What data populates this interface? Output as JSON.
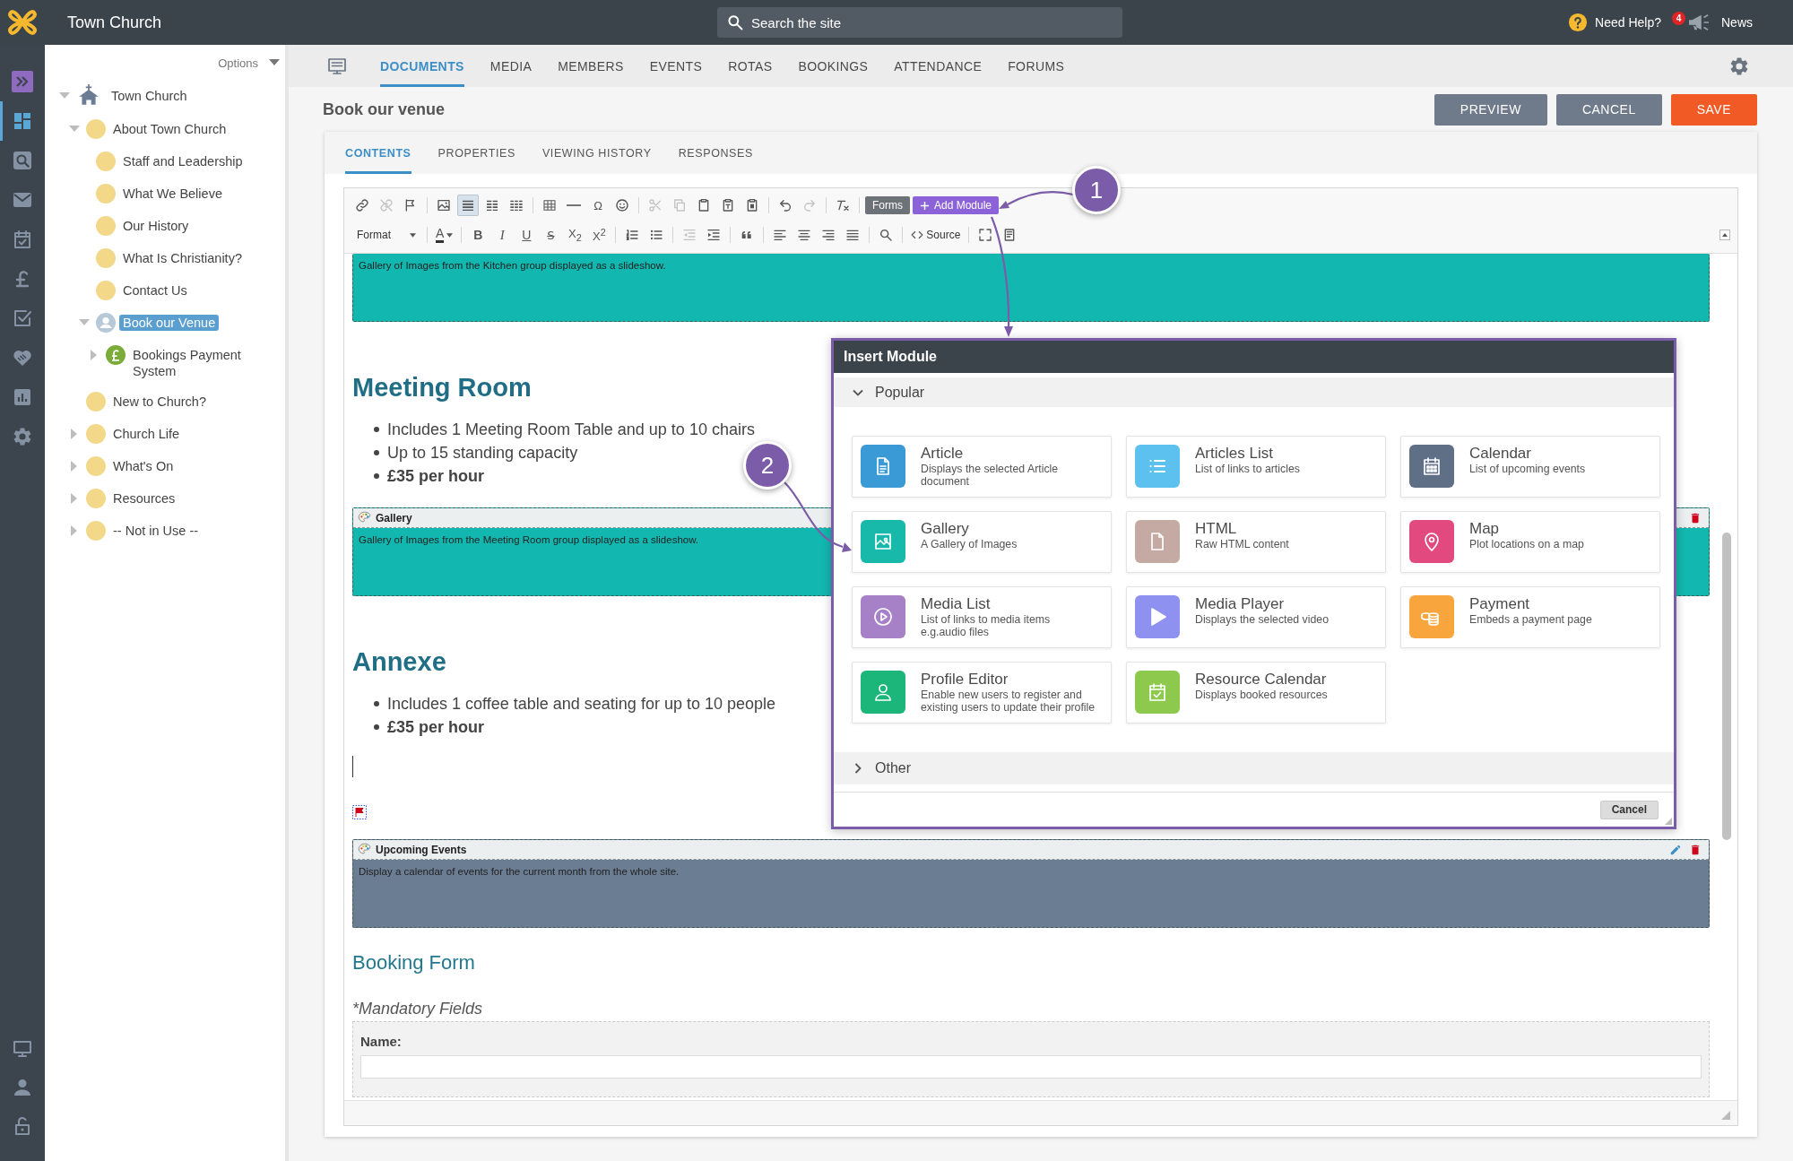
{
  "top_bar": {
    "site_name": "Town Church",
    "search": {
      "placeholder": "Search the site"
    },
    "help_label": "Need Help?",
    "news_count": "4",
    "news_label": "News"
  },
  "side_rail": {
    "items": [
      {
        "selected": true
      },
      {
        "selected": false
      },
      {
        "selected": false
      },
      {
        "selected": false
      },
      {
        "selected": false
      },
      {
        "selected": false
      },
      {
        "selected": false
      },
      {
        "selected": false
      },
      {
        "selected": false
      }
    ],
    "bottom_items": [
      {
        "selected": false
      },
      {
        "selected": false
      },
      {
        "selected": false
      }
    ]
  },
  "page_tree": {
    "options_label": "Options",
    "items": [
      {
        "label": "Town Church",
        "kind": "home",
        "expandable": true,
        "expanded": true,
        "selected": false,
        "children": [
          {
            "label": "About Town Church",
            "kind": "page",
            "expandable": true,
            "expanded": true,
            "selected": false,
            "children": [
              {
                "label": "Staff and Leadership",
                "kind": "page",
                "expandable": false,
                "selected": false
              },
              {
                "label": "What We Believe",
                "kind": "page",
                "expandable": false,
                "selected": false
              },
              {
                "label": "Our History",
                "kind": "page",
                "expandable": false,
                "selected": false
              },
              {
                "label": "What Is Christianity?",
                "kind": "page",
                "expandable": false,
                "selected": false
              },
              {
                "label": "Contact Us",
                "kind": "page",
                "expandable": false,
                "selected": false
              },
              {
                "label": "Book our Venue",
                "kind": "form",
                "expandable": true,
                "expanded": true,
                "selected": true,
                "children": [
                  {
                    "label": "Bookings Payment System",
                    "kind": "payment",
                    "expandable": true,
                    "expanded": false,
                    "selected": false
                  }
                ]
              }
            ]
          },
          {
            "label": "New to Church?",
            "kind": "page",
            "expandable": false,
            "selected": false
          },
          {
            "label": "Church Life",
            "kind": "page",
            "expandable": true,
            "expanded": false,
            "selected": false
          },
          {
            "label": "What's On",
            "kind": "page",
            "expandable": true,
            "expanded": false,
            "selected": false
          },
          {
            "label": "Resources",
            "kind": "page",
            "expandable": true,
            "expanded": false,
            "selected": false
          },
          {
            "label": "-- Not in Use --",
            "kind": "page",
            "expandable": true,
            "expanded": false,
            "selected": false
          }
        ]
      }
    ]
  },
  "nav_tabs": [
    {
      "label": "DOCUMENTS",
      "selected": true
    },
    {
      "label": "MEDIA",
      "selected": false
    },
    {
      "label": "MEMBERS",
      "selected": false
    },
    {
      "label": "EVENTS",
      "selected": false
    },
    {
      "label": "ROTAS",
      "selected": false
    },
    {
      "label": "BOOKINGS",
      "selected": false
    },
    {
      "label": "ATTENDANCE",
      "selected": false
    },
    {
      "label": "FORUMS",
      "selected": false
    }
  ],
  "page_header": {
    "title": "Book our venue",
    "buttons": [
      {
        "label": "PREVIEW",
        "kind": "secondary"
      },
      {
        "label": "CANCEL",
        "kind": "secondary"
      },
      {
        "label": "SAVE",
        "kind": "primary"
      }
    ]
  },
  "editor_tabs": [
    {
      "label": "CONTENTS",
      "selected": true
    },
    {
      "label": "PROPERTIES",
      "selected": false
    },
    {
      "label": "VIEWING HISTORY",
      "selected": false
    },
    {
      "label": "RESPONSES",
      "selected": false
    }
  ],
  "editor": {
    "toolbar": {
      "rows": [
        [
          {
            "kind": "icon",
            "disabled": false,
            "pressed": false
          },
          {
            "kind": "icon",
            "disabled": true,
            "pressed": false
          },
          {
            "kind": "icon",
            "disabled": false,
            "pressed": false
          },
          {
            "kind": "separator"
          },
          {
            "kind": "icon",
            "disabled": false,
            "pressed": false
          },
          {
            "kind": "icon",
            "disabled": false,
            "pressed": true
          },
          {
            "kind": "icon",
            "disabled": false,
            "pressed": false
          },
          {
            "kind": "icon",
            "disabled": false,
            "pressed": false
          },
          {
            "kind": "separator"
          },
          {
            "kind": "icon",
            "disabled": false,
            "pressed": false
          },
          {
            "kind": "icon",
            "disabled": false,
            "pressed": false
          },
          {
            "kind": "glyph",
            "label": "Ω",
            "disabled": false,
            "pressed": false
          },
          {
            "kind": "icon",
            "disabled": false,
            "pressed": false
          },
          {
            "kind": "separator"
          },
          {
            "kind": "icon",
            "disabled": true,
            "pressed": false
          },
          {
            "kind": "icon",
            "disabled": true,
            "pressed": false
          },
          {
            "kind": "icon",
            "disabled": false,
            "pressed": false
          },
          {
            "kind": "icon",
            "disabled": false,
            "pressed": false
          },
          {
            "kind": "icon",
            "disabled": false,
            "pressed": false
          },
          {
            "kind": "separator"
          },
          {
            "kind": "icon",
            "disabled": false,
            "pressed": false
          },
          {
            "kind": "icon",
            "disabled": true,
            "pressed": false
          },
          {
            "kind": "separator"
          },
          {
            "kind": "icon",
            "disabled": false,
            "pressed": false
          },
          {
            "kind": "separator"
          },
          {
            "kind": "button",
            "label": "Forms"
          },
          {
            "kind": "button",
            "label": "Add Module"
          }
        ],
        [
          {
            "kind": "dropdown",
            "label": "Format"
          },
          {
            "kind": "separator"
          },
          {
            "kind": "color",
            "label": "A"
          },
          {
            "kind": "separator"
          },
          {
            "kind": "glyph",
            "label": "B",
            "disabled": false,
            "pressed": false
          },
          {
            "kind": "glyph",
            "label": "I",
            "disabled": false,
            "pressed": false
          },
          {
            "kind": "glyph",
            "label": "U",
            "disabled": false,
            "pressed": false
          },
          {
            "kind": "glyph",
            "label": "S̶",
            "disabled": false,
            "pressed": false
          },
          {
            "kind": "glyph",
            "label": "X$_{2}$",
            "disabled": false,
            "pressed": false
          },
          {
            "kind": "glyph",
            "label": "X$^{2}$",
            "disabled": false,
            "pressed": false
          },
          {
            "kind": "separator"
          },
          {
            "kind": "icon",
            "disabled": false,
            "pressed": false
          },
          {
            "kind": "icon",
            "disabled": false,
            "pressed": false
          },
          {
            "kind": "separator"
          },
          {
            "kind": "icon",
            "disabled": true,
            "pressed": false
          },
          {
            "kind": "icon",
            "disabled": false,
            "pressed": false
          },
          {
            "kind": "separator"
          },
          {
            "kind": "icon",
            "disabled": false,
            "pressed": false
          },
          {
            "kind": "separator"
          },
          {
            "kind": "icon",
            "disabled": false,
            "pressed": false
          },
          {
            "kind": "icon",
            "disabled": false,
            "pressed": false
          },
          {
            "kind": "icon",
            "disabled": false,
            "pressed": false
          },
          {
            "kind": "icon",
            "disabled": false,
            "pressed": false
          },
          {
            "kind": "separator"
          },
          {
            "kind": "icon",
            "disabled": false,
            "pressed": false
          },
          {
            "kind": "separator"
          },
          {
            "kind": "labeled",
            "label": "Source"
          },
          {
            "kind": "separator"
          },
          {
            "kind": "icon",
            "disabled": false,
            "pressed": false
          },
          {
            "kind": "icon",
            "disabled": false,
            "pressed": false
          }
        ]
      ]
    },
    "content": [
      {
        "kind": "module",
        "color": "#12b8b0",
        "description": "Gallery of Images from the Kitchen group displayed as a slideshow."
      },
      {
        "kind": "heading",
        "text": "Meeting Room"
      },
      {
        "kind": "bullets",
        "items": [
          {
            "text": "Includes 1 Meeting Room Table and up to 10 chairs",
            "bold": false
          },
          {
            "text": "Up to 15 standing capacity",
            "bold": false
          },
          {
            "text": "£35 per hour",
            "bold": true
          }
        ]
      },
      {
        "kind": "module",
        "color": "#12b8b0",
        "title": "Gallery",
        "edit_icon": false,
        "description": "Gallery of Images from the Meeting Room group displayed as a slideshow."
      },
      {
        "kind": "heading",
        "text": "Annexe"
      },
      {
        "kind": "bullets",
        "items": [
          {
            "text": "Includes 1 coffee table and seating for up to 10 people",
            "bold": false
          },
          {
            "text": "£35 per hour",
            "bold": true
          }
        ]
      },
      {
        "kind": "cursor"
      },
      {
        "kind": "anchor"
      },
      {
        "kind": "module",
        "color": "#6b7d93",
        "title": "Upcoming Events",
        "edit_icon": true,
        "description": "Display a calendar of events for the current month from the whole site."
      },
      {
        "kind": "subheading",
        "text": "Booking Form"
      },
      {
        "kind": "note",
        "text": "*Mandatory Fields"
      },
      {
        "kind": "field",
        "label": "Name:"
      }
    ]
  },
  "insert_module_dialog": {
    "title": "Insert Module",
    "sections": [
      {
        "label": "Popular",
        "expanded": true,
        "modules": [
          {
            "name": "Article",
            "description": "Displays the selected Article document",
            "color": "#3a9ad6"
          },
          {
            "name": "Articles List",
            "description": "List of links to articles",
            "color": "#5cc1ee"
          },
          {
            "name": "Calendar",
            "description": "List of upcoming events",
            "color": "#5f6f86"
          },
          {
            "name": "Gallery",
            "description": "A Gallery of Images",
            "color": "#18b8ab"
          },
          {
            "name": "HTML",
            "description": "Raw HTML content",
            "color": "#c5aaa3"
          },
          {
            "name": "Map",
            "description": "Plot locations on a map",
            "color": "#e2497f"
          },
          {
            "name": "Media List",
            "description": "List of links to media items e.g.audio files",
            "color": "#a781c7"
          },
          {
            "name": "Media Player",
            "description": "Displays the selected video",
            "color": "#8e91ef"
          },
          {
            "name": "Payment",
            "description": "Embeds a payment page",
            "color": "#f8a53d"
          },
          {
            "name": "Profile Editor",
            "description": "Enable new users to register and existing users to update their profile",
            "color": "#1cb57a"
          },
          {
            "name": "Resource Calendar",
            "description": "Displays booked resources",
            "color": "#8cc94d"
          }
        ]
      },
      {
        "label": "Other",
        "expanded": false
      }
    ],
    "cancel_label": "Cancel"
  },
  "callouts": [
    {
      "number": "1"
    },
    {
      "number": "2"
    }
  ]
}
